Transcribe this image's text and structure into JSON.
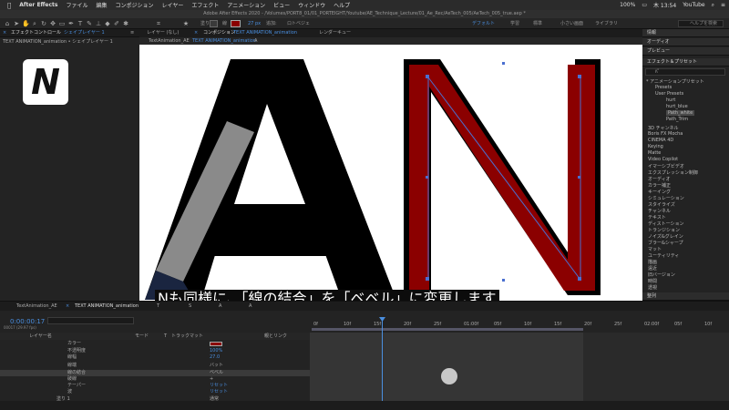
{
  "menubar": {
    "apple": "",
    "app": "After Effects",
    "items": [
      "ファイル",
      "編集",
      "コンポジション",
      "レイヤー",
      "エフェクト",
      "アニメーション",
      "ビュー",
      "ウィンドウ",
      "ヘルプ"
    ],
    "status": {
      "battery": "100%",
      "time": "木 13:54",
      "youtube": "YouTube"
    }
  },
  "titlebar": {
    "text": "Adobe After Effects 2020 - /Volumes/PORT8_01/01_PORTEIGHT/Youtube/AE_Technique_Lecture/01_Ae_Rec/AeTech_005/AeTech_005_true.aep *"
  },
  "toolbar": {
    "fill_label": "塗り",
    "stroke_label": "線",
    "stroke_width": "27 px",
    "add_label": "追加:",
    "rotobezier": "ロトベジェ",
    "workspaces": [
      "デフォルト",
      "学習",
      "標準",
      "小さい画面",
      "ライブラリ"
    ],
    "search_placeholder": "ヘルプを検索"
  },
  "left_panel": {
    "tab1": "エフェクトコントロール",
    "tab1_layer": "シェイプレイヤー 1",
    "subtitle": "TEXT ANIMATION_animation • シェイプレイヤー 1",
    "thumb_letter": "N"
  },
  "viewer": {
    "tabs": [
      "レイヤー (なし)",
      "コンポジション",
      "TEXT ANIMATION_animation",
      "レンダーキュー"
    ],
    "subtabs": [
      "TextAnimation_AE",
      "TEXT ANIMATION_animation",
      "A"
    ],
    "canvas_letters": [
      "A",
      "N"
    ]
  },
  "subtitle": {
    "text": "Nも同様に、「線の結合」を「ベベル」に変更します"
  },
  "right_panel": {
    "sections": [
      "情報",
      "オーディオ",
      "プレビュー",
      "エフェクト＆プリセット"
    ],
    "search": "ﾊﾟ",
    "tree": [
      "* アニメーションプリセット",
      "Presets",
      "User Presets",
      "hurt",
      "hurt_blue",
      "Path_white",
      "Path_Trim"
    ],
    "categories": [
      "3D チャンネル",
      "Boris FX Mocha",
      "CINEMA 4D",
      "Keying",
      "Matte",
      "Video Copilot",
      "イマーシブビデオ",
      "エクスプレッション制御",
      "オーディオ",
      "カラー補正",
      "キーイング",
      "シミュレーション",
      "スタイライズ",
      "チャンネル",
      "テキスト",
      "ディストーション",
      "トランジション",
      "ノイズ&グレイン",
      "ブラー&シャープ",
      "マット",
      "ユーティリティ",
      "描画",
      "遠近",
      "旧バージョン",
      "時間",
      "透視"
    ],
    "bottom": "整列"
  },
  "timeline": {
    "tabs": [
      "TextAnimation_AE",
      "TEXT ANIMATION_animation",
      "T",
      "S",
      "A",
      "A"
    ],
    "timecode": "0:00:00:17",
    "fps": "00017 (29.97 fps)",
    "col_headers": [
      "レイヤー名",
      "モード",
      "T",
      "トラックマット",
      "親とリンク"
    ],
    "rows": [
      {
        "name": "カラー",
        "value": ""
      },
      {
        "name": "不透明度",
        "value": "100%"
      },
      {
        "name": "線幅",
        "value": "27.0"
      },
      {
        "name": "線端",
        "value": "バット"
      },
      {
        "name": "線の結合",
        "value": "ベベル"
      },
      {
        "name": "破線",
        "value": "+"
      },
      {
        "name": "テーパー",
        "value": "リセット"
      },
      {
        "name": "波",
        "value": "リセット"
      },
      {
        "name": "塗り 1",
        "value": "通常"
      }
    ],
    "ruler": [
      "0f",
      "10f",
      "15f",
      "20f",
      "25f",
      "01:00f",
      "05f",
      "10f",
      "15f",
      "20f",
      "25f",
      "02:00f",
      "05f",
      "10f"
    ]
  },
  "colors": {
    "accent": "#4a8fe0",
    "stroke": "#8b0000"
  }
}
